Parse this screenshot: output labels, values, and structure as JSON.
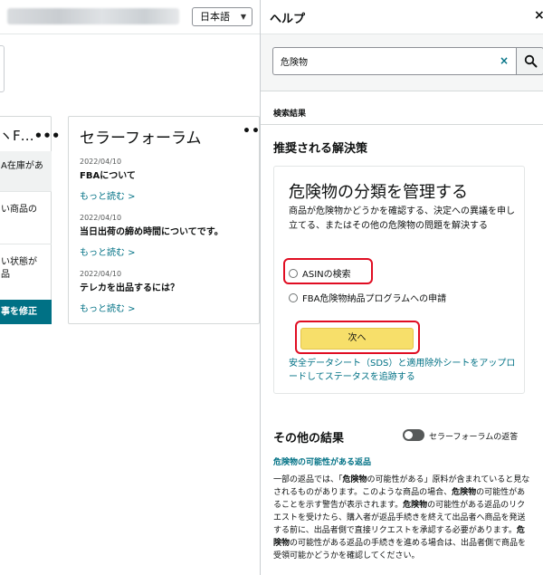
{
  "left": {
    "language_selector": "日本語",
    "card1": {
      "title": "ヽF…",
      "more_dots": "•••",
      "row1": "A在庫があ",
      "row2a": "い商品の",
      "row3a": "い状態が",
      "row3b": "品",
      "button": "事を修正"
    },
    "forum": {
      "title": "セラーフォーラム",
      "more_dots": "•••",
      "posts": [
        {
          "date": "2022/04/10",
          "title": "FBAについて",
          "read_more": "もっと読む >"
        },
        {
          "date": "2022/04/10",
          "title": "当日出荷の締め時間についてです。",
          "read_more": "もっと読む >"
        },
        {
          "date": "2022/04/10",
          "title": "テレカを出品するには？",
          "read_more": "もっと読む >"
        }
      ]
    }
  },
  "help": {
    "title": "ヘルプ",
    "close": "×",
    "search": {
      "value": "危険物",
      "clear": "×"
    },
    "results_label": "検索結果",
    "recommended_title": "推奨される解決策",
    "solution": {
      "title": "危険物の分類を管理する",
      "description": "商品が危険物かどうかを確認する、決定への異議を申し立てる、またはその他の危険物の問題を解決する",
      "options": [
        "ASINの検索",
        "FBA危険物納品プログラムへの申請"
      ],
      "next_button": "次へ",
      "sds_link": "安全データシート（SDS）と適用除外シートをアップロードしてステータスを追跡する"
    },
    "other_results": {
      "title": "その他の結果",
      "toggle_label": "セラーフォーラムの返答",
      "result_link": "危険物の可能性がある返品",
      "body_parts": [
        "一部の返品では、「",
        "危険物",
        "の可能性がある」原料が含まれていると見なされるものがあります。このような商品の場合、",
        "危険物",
        "の可能性があることを示す警告が表示されます。",
        "危険物",
        "の可能性がある返品のリクエストを受けたら、購入者が返品手続きを終えて出品者へ商品を発送する前に、出品者側で直接リクエストを承認する必要があります。",
        "危険物",
        "の可能性がある返品の手続きを進める場合は、出品者側で商品を受領可能かどうかを確認してください。"
      ]
    }
  },
  "colors": {
    "link": "#007185",
    "primary_button": "#f7df6a",
    "highlight": "#e00d22",
    "dark_button": "#007185"
  }
}
